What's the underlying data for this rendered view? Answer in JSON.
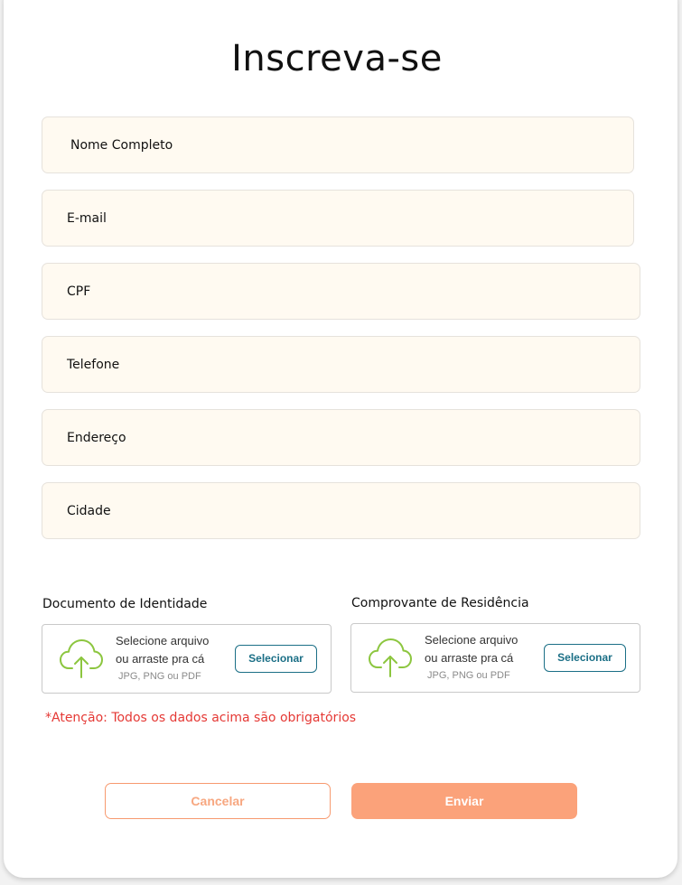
{
  "form": {
    "title": "Inscreva-se",
    "fields": [
      {
        "label": "Nome Completo"
      },
      {
        "label": "E-mail"
      },
      {
        "label": "CPF"
      },
      {
        "label": "Telefone"
      },
      {
        "label": "Endereço"
      },
      {
        "label": "Cidade"
      }
    ],
    "uploads": [
      {
        "title": "Documento de Identidade",
        "line1": "Selecione arquivo",
        "line2": "ou arraste pra cá",
        "hint": "JPG, PNG ou PDF",
        "button": "Selecionar",
        "icon": "cloud-upload-icon"
      },
      {
        "title": "Comprovante de Residência",
        "line1": "Selecione arquivo",
        "line2": "ou arraste pra cá",
        "hint": "JPG, PNG ou PDF",
        "button": "Selecionar",
        "icon": "cloud-upload-icon"
      }
    ],
    "warning": "*Atenção: Todos os dados acima são obrigatórios",
    "cancel_label": "Cancelar",
    "submit_label": "Enviar"
  },
  "colors": {
    "field_bg": "#fffaf1",
    "accent_orange": "#fba27a",
    "select_teal": "#1b6f86",
    "icon_green": "#8cc63f",
    "warning_red": "#e53935"
  }
}
